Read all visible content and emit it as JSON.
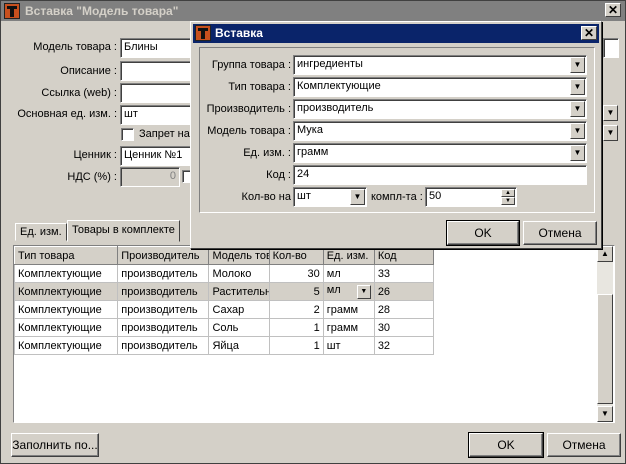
{
  "main": {
    "title": "Вставка \"Модель товара\"",
    "fields": {
      "model_label": "Модель товара :",
      "model_value": "Блины",
      "desc_label": "Описание :",
      "link_label": "Ссылка (web) :",
      "unit_label": "Основная ед. изм. :",
      "unit_value": "шт",
      "ban_label": "Запрет на",
      "price_label": "Ценник :",
      "price_value": "Ценник №1",
      "vat_label": "НДС (%) :",
      "vat_value": "0"
    },
    "tabs": [
      "Ед. изм.",
      "Товары в комплекте"
    ],
    "table": {
      "headers": [
        "Тип товара",
        "Производитель",
        "Модель товара",
        "Кол-во",
        "Ед. изм.",
        "Код"
      ],
      "rows": [
        [
          "Комплектующие",
          "производитель",
          "Молоко",
          "30",
          "мл",
          "33"
        ],
        [
          "Комплектующие",
          "производитель",
          "Растительн",
          "5",
          "мл",
          "26"
        ],
        [
          "Комплектующие",
          "производитель",
          "Сахар",
          "2",
          "грамм",
          "28"
        ],
        [
          "Комплектующие",
          "производитель",
          "Соль",
          "1",
          "грамм",
          "30"
        ],
        [
          "Комплектующие",
          "производитель",
          "Яйца",
          "1",
          "шт",
          "32"
        ]
      ]
    },
    "fill_button": "Заполнить по...",
    "ok_button": "OK",
    "cancel_button": "Отмена",
    "close_symbol": "✕"
  },
  "dialog": {
    "title": "Вставка",
    "group_label": "Группа товара :",
    "group_value": "ингредиенты",
    "type_label": "Тип товара :",
    "type_value": "Комплектующие",
    "maker_label": "Производитель :",
    "maker_value": "производитель",
    "model_label": "Модель товара :",
    "model_value": "Мука",
    "unit_label": "Ед. изм. :",
    "unit_value": "грамм",
    "code_label": "Код :",
    "code_value": "24",
    "qty_label": "Кол-во на",
    "qty_unit": "шт",
    "kit_label": "компл-та :",
    "kit_value": "50",
    "ok_button": "OK",
    "cancel_button": "Отмена",
    "close_symbol": "✕"
  }
}
